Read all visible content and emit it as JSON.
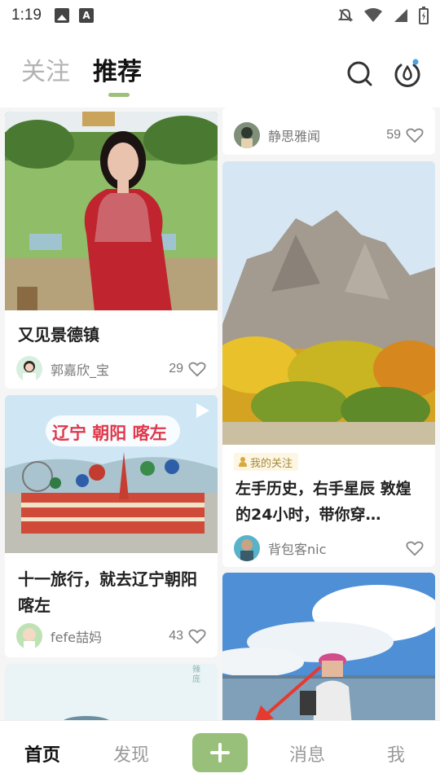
{
  "status_bar": {
    "time": "1:19",
    "left_icons": [
      "image-icon",
      "text-a-icon"
    ],
    "right_icons": [
      "bell-off-icon",
      "wifi-icon",
      "signal-icon",
      "battery-icon"
    ]
  },
  "header": {
    "tabs": [
      {
        "label": "关注",
        "active": false
      },
      {
        "label": "推荐",
        "active": true
      }
    ],
    "icons": [
      "search-icon",
      "water-drop-icon"
    ],
    "accent": "#9cc27a"
  },
  "feed": {
    "left": [
      {
        "title": "又见景德镇",
        "author": "郭嘉欣_宝",
        "likes": "29"
      },
      {
        "title": "十一旅行，就去辽宁朝阳喀左",
        "overlay_text": "辽宁 朝阳 喀左",
        "author": "fefe喆妈",
        "likes": "43",
        "video": true
      },
      {
        "partial_text": "辣 庞"
      }
    ],
    "right": [
      {
        "author": "静思雅闻",
        "likes": "59"
      },
      {
        "badge": "我的关注",
        "title": "左手历史，右手星辰 敦煌的24小时，带你穿…",
        "author": "背包客nic",
        "likes": ""
      },
      {
        "partial": true
      }
    ]
  },
  "bottom_nav": {
    "items": [
      "首页",
      "发现",
      "消息",
      "我"
    ],
    "active": "首页",
    "add_icon": "plus-icon",
    "add_color": "#98c07a"
  }
}
